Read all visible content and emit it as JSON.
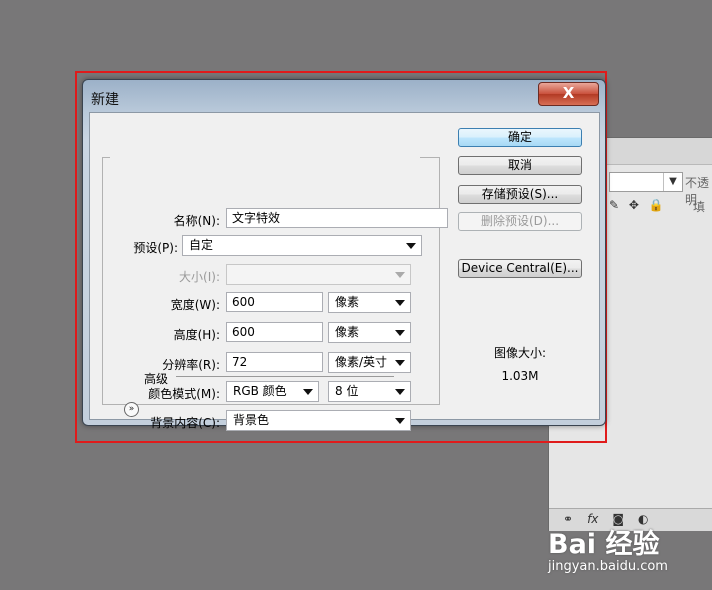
{
  "dialog": {
    "title": "新建",
    "close_label": "X",
    "fields": {
      "name_label": "名称(N):",
      "name_value": "文字特效",
      "preset_label": "预设(P):",
      "preset_value": "自定",
      "size_label": "大小(I):",
      "size_value": "",
      "width_label": "宽度(W):",
      "width_value": "600",
      "width_unit": "像素",
      "height_label": "高度(H):",
      "height_value": "600",
      "height_unit": "像素",
      "resolution_label": "分辨率(R):",
      "resolution_value": "72",
      "resolution_unit": "像素/英寸",
      "color_mode_label": "颜色模式(M):",
      "color_mode_value": "RGB 颜色",
      "bit_depth_value": "8 位",
      "background_label": "背景内容(C):",
      "background_value": "背景色",
      "advanced_label": "高级"
    },
    "buttons": {
      "ok": "确定",
      "cancel": "取消",
      "save_preset": "存储预设(S)...",
      "delete_preset": "删除预设(D)...",
      "device_central": "Device Central(E)..."
    },
    "image_size_label": "图像大小:",
    "image_size_value": "1.03M"
  },
  "layers_panel": {
    "opacity_label": "不透明",
    "fill_label": "填"
  },
  "watermark": {
    "logo": "Bai 经验",
    "url": "jingyan.baidu.com"
  },
  "colors": {
    "highlight": "#e01b1b",
    "backdrop": "#787778",
    "close_button": "#c9503c"
  }
}
